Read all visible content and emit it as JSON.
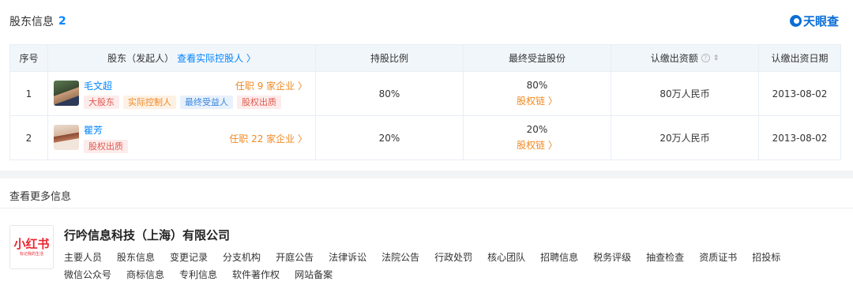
{
  "header": {
    "title": "股东信息",
    "count": "2",
    "brand": "天眼查"
  },
  "table": {
    "columns": {
      "index": "序号",
      "holder": "股东（发起人）",
      "holder_link": "查看实际控股人",
      "ratio": "持股比例",
      "final_share": "最终受益股份",
      "capital": "认缴出资额",
      "date": "认缴出资日期"
    },
    "rows": [
      {
        "index": "1",
        "name": "毛文超",
        "tags": [
          "大股东",
          "实际控制人",
          "最终受益人",
          "股权出质"
        ],
        "post": "任职 9 家企业",
        "ratio": "80%",
        "final_share": "80%",
        "chain": "股权链",
        "capital": "80万人民币",
        "date": "2013-08-02"
      },
      {
        "index": "2",
        "name": "瞿芳",
        "tags": [
          "股权出质"
        ],
        "post": "任职 22 家企业",
        "ratio": "20%",
        "final_share": "20%",
        "chain": "股权链",
        "capital": "20万人民币",
        "date": "2013-08-02"
      }
    ]
  },
  "more": {
    "title": "查看更多信息",
    "logo_text": "小红书",
    "logo_sub": "标记我的生活",
    "company_name": "行吟信息科技（上海）有限公司",
    "links": [
      "主要人员",
      "股东信息",
      "变更记录",
      "分支机构",
      "开庭公告",
      "法律诉讼",
      "法院公告",
      "行政处罚",
      "核心团队",
      "招聘信息",
      "税务评级",
      "抽查检查",
      "资质证书",
      "招投标",
      "微信公众号",
      "商标信息",
      "专利信息",
      "软件著作权",
      "网站备案"
    ]
  },
  "colors": {
    "accent": "#0084ff",
    "orange": "#f08a24",
    "brand": "#0a6dd6",
    "logo_red": "#ea2630"
  }
}
